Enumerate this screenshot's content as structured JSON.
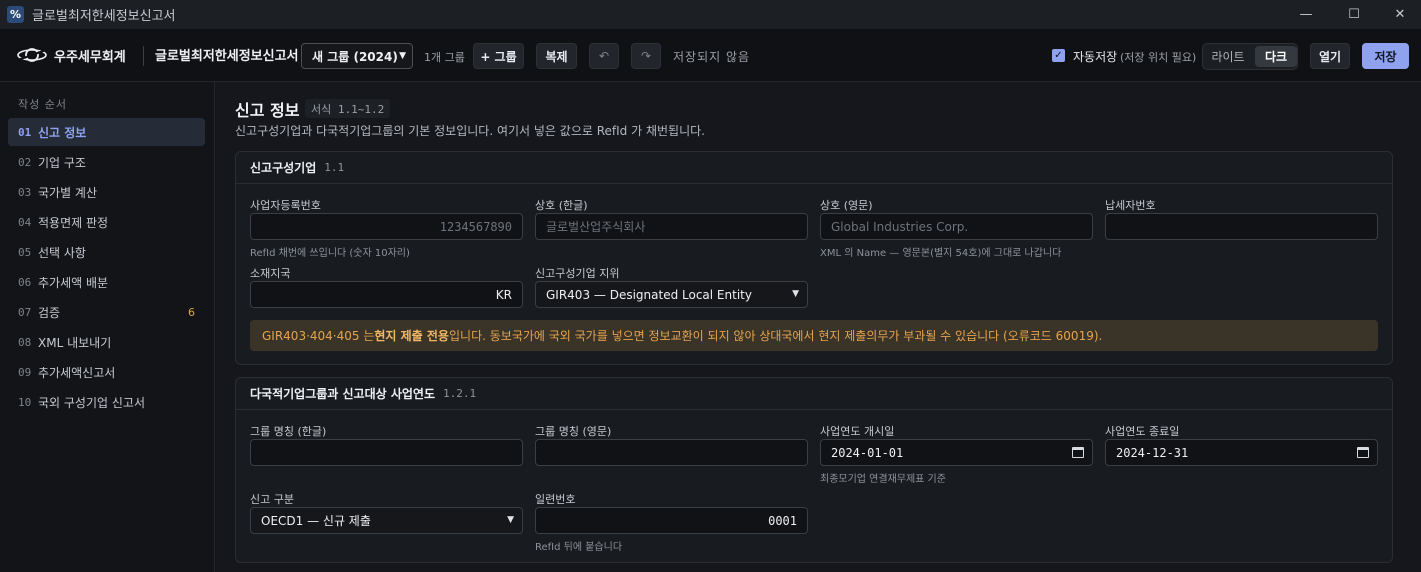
{
  "window": {
    "title": "글로벌최저한세정보신고서",
    "app_icon": "%",
    "minimize": "—",
    "maximize": "☐",
    "close": "✕"
  },
  "toolbar": {
    "brand": "우주세무회계",
    "doc_title": "글로벌최저한세정보신고서",
    "group_select": "새 그룹 (2024)",
    "group_count": "1개 그룹",
    "add_group": "+ 그룹",
    "duplicate": "복제",
    "undo": "↶",
    "redo": "↷",
    "unsaved": "저장되지 않음",
    "autosave_label": "자동저장",
    "autosave_checked": true,
    "autosave_note": "(저장 위치 필요)",
    "theme_light": "라이트",
    "theme_dark": "다크",
    "theme_selected": "dark",
    "open": "열기",
    "save": "저장",
    "accent_color": "#8ea2f0"
  },
  "sidebar": {
    "heading": "작성 순서",
    "items": [
      {
        "num": "01",
        "label": "신고 정보",
        "active": true
      },
      {
        "num": "02",
        "label": "기업 구조"
      },
      {
        "num": "03",
        "label": "국가별 계산"
      },
      {
        "num": "04",
        "label": "적용면제 판정"
      },
      {
        "num": "05",
        "label": "선택 사항"
      },
      {
        "num": "06",
        "label": "추가세액 배분"
      },
      {
        "num": "07",
        "label": "검증",
        "badge": "6"
      },
      {
        "num": "08",
        "label": "XML 내보내기"
      },
      {
        "num": "09",
        "label": "추가세액신고서"
      },
      {
        "num": "10",
        "label": "국외 구성기업 신고서"
      }
    ]
  },
  "main": {
    "title": "신고 정보",
    "form_tag": "서식 1.1~1.2",
    "description": "신고구성기업과 다국적기업그룹의 기본 정보입니다. 여기서 넣은 값으로 RefId 가 채번됩니다."
  },
  "card1": {
    "title": "신고구성기업",
    "code": "1.1",
    "brn": {
      "label": "사업자등록번호",
      "placeholder": "1234567890",
      "help": "RefId 채번에 쓰입니다 (숫자 10자리)"
    },
    "name_kr": {
      "label": "상호 (한글)",
      "placeholder": "글로벌산업주식회사"
    },
    "name_en": {
      "label": "상호 (영문)",
      "placeholder": "Global Industries Corp.",
      "help": "XML 의 Name — 영문본(별지 54호)에 그대로 나갑니다"
    },
    "tin": {
      "label": "납세자번호",
      "value": ""
    },
    "jurisdiction": {
      "label": "소재지국",
      "value": "KR"
    },
    "role": {
      "label": "신고구성기업 지위",
      "value": "GIR403 — Designated Local Entity"
    },
    "warning_prefix": "GIR403·404·405 는 ",
    "warning_bold": "현지 제출 전용",
    "warning_suffix": "입니다. 동보국가에 국외 국가를 넣으면 정보교환이 되지 않아 상대국에서 현지 제출의무가 부과될 수 있습니다 (오류코드 60019)."
  },
  "card2": {
    "title": "다국적기업그룹과 신고대상 사업연도",
    "code": "1.2.1",
    "group_kr": {
      "label": "그룹 명칭 (한글)",
      "value": ""
    },
    "group_en": {
      "label": "그룹 명칭 (영문)",
      "value": ""
    },
    "fy_start": {
      "label": "사업연도 개시일",
      "value": "2024-01-01",
      "help": "최종모기업 연결재무제표 기준"
    },
    "fy_end": {
      "label": "사업연도 종료일",
      "value": "2024-12-31"
    },
    "filing_type": {
      "label": "신고 구분",
      "value": "OECD1 — 신규 제출"
    },
    "serial": {
      "label": "일련번호",
      "value": "0001",
      "help": "RefId 뒤에 붙습니다"
    }
  }
}
